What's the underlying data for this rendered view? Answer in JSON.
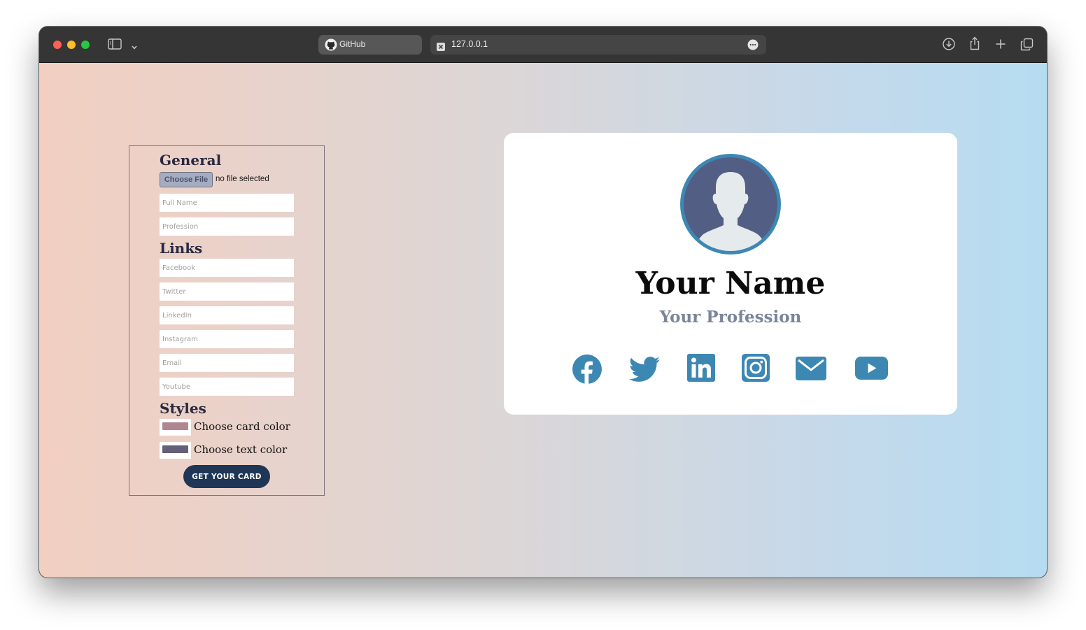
{
  "browser": {
    "tabs": [
      {
        "label": "GitHub",
        "icon": "github-icon"
      },
      {
        "label": "127.0.0.1",
        "icon": "close-icon"
      }
    ]
  },
  "form": {
    "sections": {
      "general": "General",
      "links": "Links",
      "styles": "Styles"
    },
    "file_button": "Choose File",
    "file_status": "no file selected",
    "placeholders": {
      "full_name": "Full Name",
      "profession": "Profession",
      "facebook": "Facebook",
      "twitter": "Twitter",
      "linkedin": "LinkedIn",
      "instagram": "Instagram",
      "email": "Email",
      "youtube": "Youtube"
    },
    "card_color_label": "Choose card color",
    "text_color_label": "Choose text color",
    "card_color": "#b08790",
    "text_color": "#65607a",
    "submit_label": "GET YOUR CARD"
  },
  "card": {
    "name": "Your Name",
    "profession": "Your Profession",
    "accent": "#3d88b3",
    "social_icons": [
      "facebook-icon",
      "twitter-icon",
      "linkedin-icon",
      "instagram-icon",
      "email-icon",
      "youtube-icon"
    ]
  }
}
